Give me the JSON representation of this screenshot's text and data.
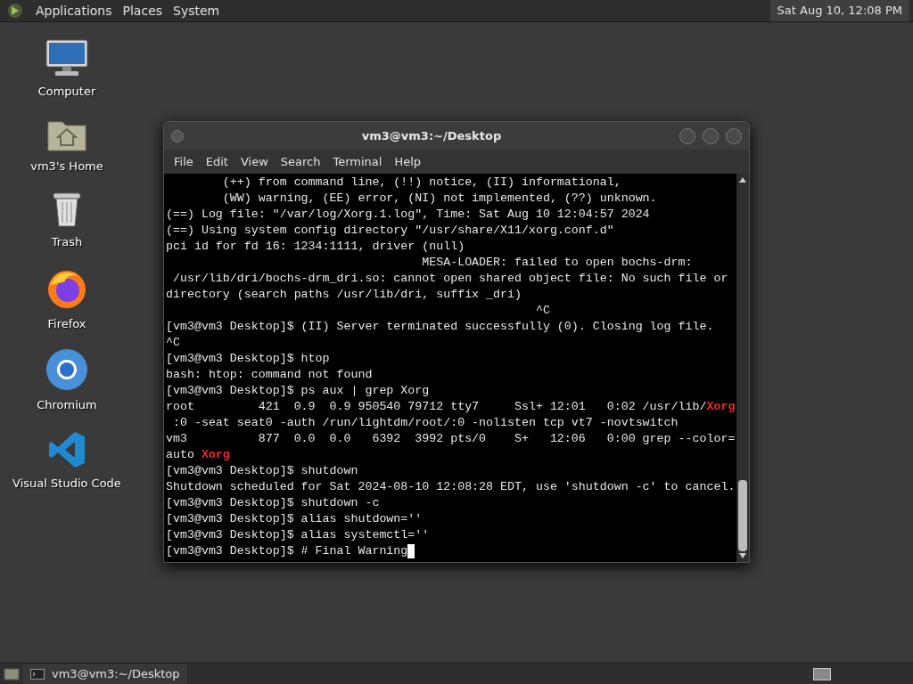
{
  "top_panel": {
    "menus": [
      "Applications",
      "Places",
      "System"
    ],
    "clock": "Sat Aug 10, 12:08 PM"
  },
  "desktop_icons": [
    {
      "kind": "computer",
      "label": "Computer"
    },
    {
      "kind": "home",
      "label": "vm3's Home"
    },
    {
      "kind": "trash",
      "label": "Trash"
    },
    {
      "kind": "firefox",
      "label": "Firefox"
    },
    {
      "kind": "chromium",
      "label": "Chromium"
    },
    {
      "kind": "vscode",
      "label": "Visual Studio Code"
    }
  ],
  "terminal_window": {
    "title": "vm3@vm3:~/Desktop",
    "menus": [
      "File",
      "Edit",
      "View",
      "Search",
      "Terminal",
      "Help"
    ],
    "lines": [
      "        (++) from command line, (!!) notice, (II) informational,",
      "        (WW) warning, (EE) error, (NI) not implemented, (??) unknown.",
      "(==) Log file: \"/var/log/Xorg.1.log\", Time: Sat Aug 10 12:04:57 2024",
      "(==) Using system config directory \"/usr/share/X11/xorg.conf.d\"",
      "pci id for fd 16: 1234:1111, driver (null)",
      "                                    MESA-LOADER: failed to open bochs-drm:",
      " /usr/lib/dri/bochs-drm_dri.so: cannot open shared object file: No such file or",
      "directory (search paths /usr/lib/dri, suffix _dri)",
      "                                                    ^C",
      "[vm3@vm3 Desktop]$ (II) Server terminated successfully (0). Closing log file.",
      "^C",
      "[vm3@vm3 Desktop]$ htop",
      "bash: htop: command not found",
      "[vm3@vm3 Desktop]$ ps aux | grep Xorg",
      "root         421  0.9  0.9 950540 79712 tty7     Ssl+ 12:01   0:02 /usr/lib/**Xorg**",
      " :0 -seat seat0 -auth /run/lightdm/root/:0 -nolisten tcp vt7 -novtswitch",
      "vm3          877  0.0  0.0   6392  3992 pts/0    S+   12:06   0:00 grep --color=",
      "auto **Xorg**",
      "[vm3@vm3 Desktop]$ shutdown",
      "Shutdown scheduled for Sat 2024-08-10 12:08:28 EDT, use 'shutdown -c' to cancel.",
      "[vm3@vm3 Desktop]$ shutdown -c",
      "[vm3@vm3 Desktop]$ alias shutdown=''",
      "[vm3@vm3 Desktop]$ alias systemctl=''",
      "[vm3@vm3 Desktop]$ # Final Warning"
    ],
    "cursor_visible": true
  },
  "bottom_panel": {
    "tasks": [
      {
        "label": "vm3@vm3:~/Desktop",
        "selected": false
      }
    ]
  }
}
